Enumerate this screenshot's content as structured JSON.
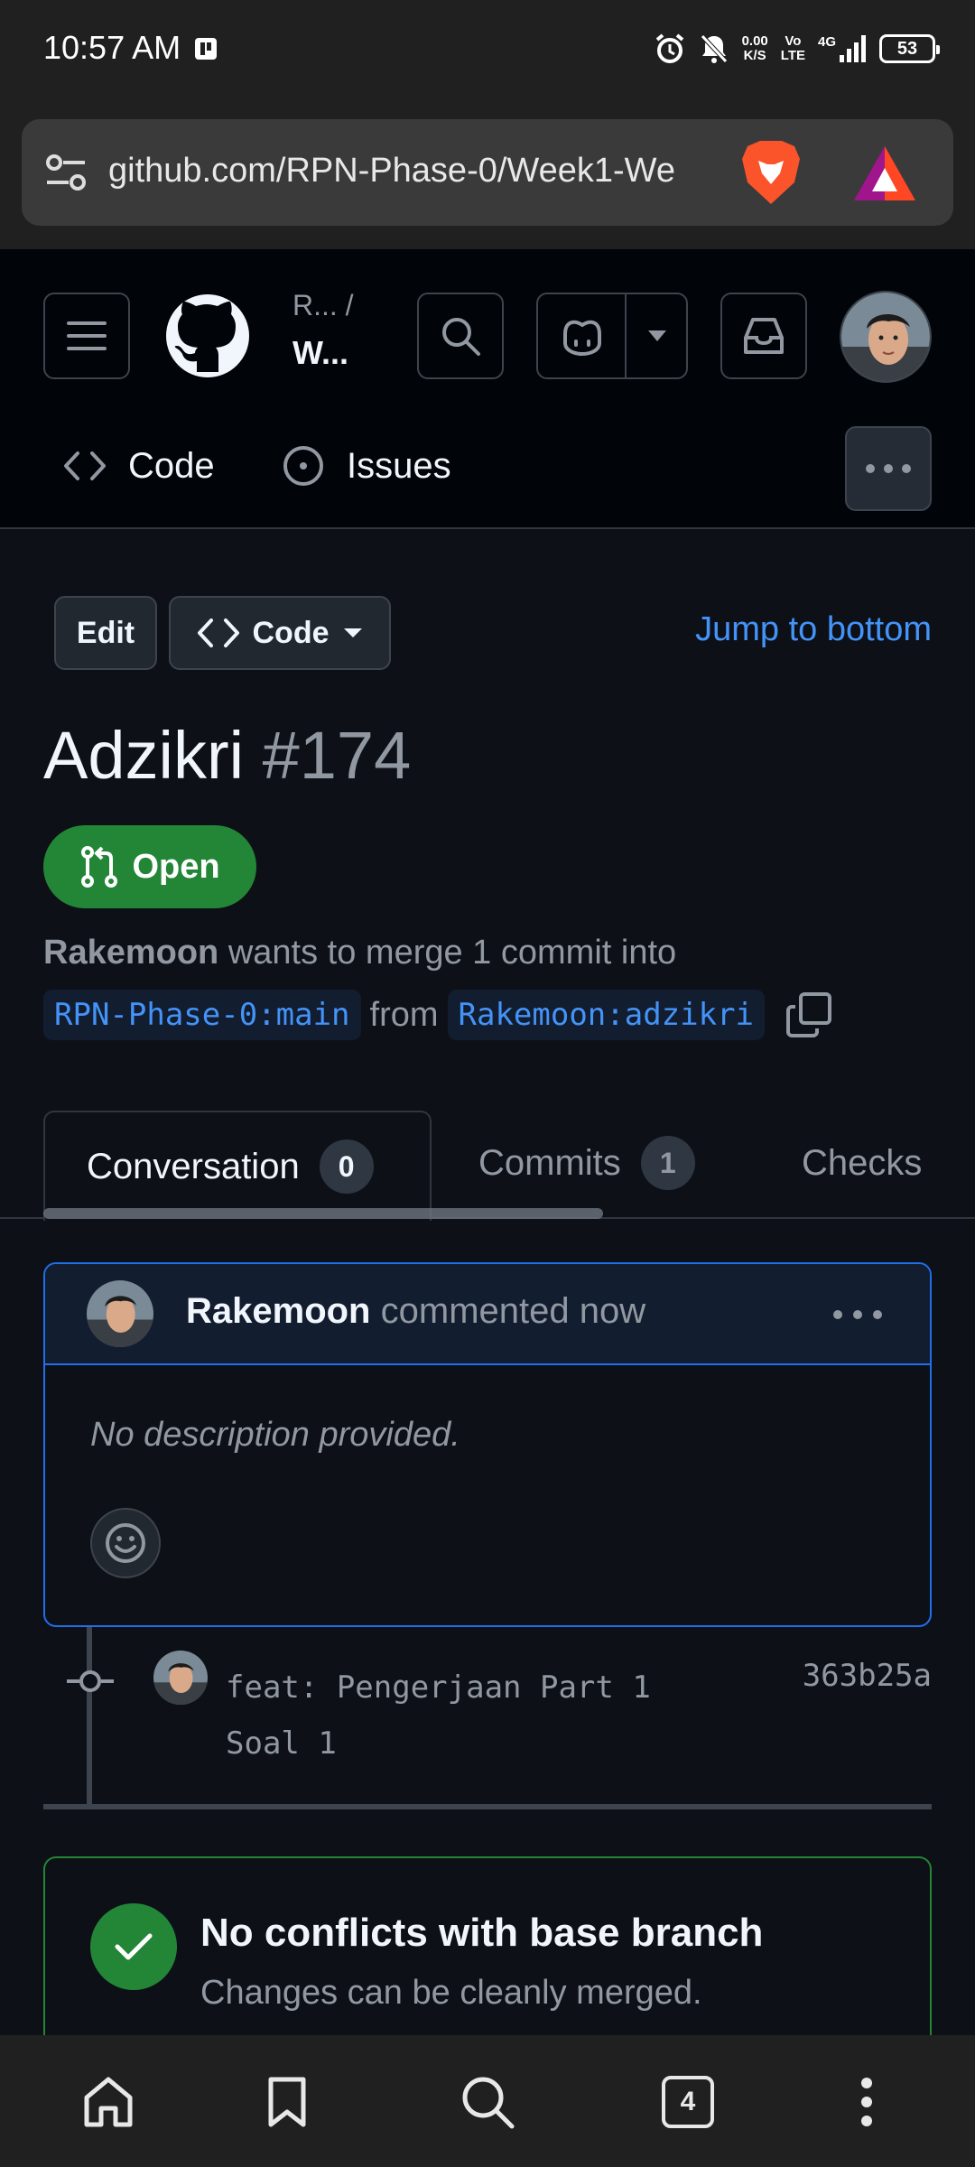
{
  "status_bar": {
    "time": "10:57 AM",
    "net_speed_value": "0.00",
    "net_speed_unit": "K/S",
    "volte_top": "Vo",
    "volte_bottom": "LTE",
    "network_type": "4G",
    "battery_level": "53"
  },
  "browser": {
    "url": "github.com/RPN-Phase-0/Week1-We",
    "open_tab_count": "4"
  },
  "github_header": {
    "owner_truncated": "R... /",
    "repo_truncated": "W..."
  },
  "repo_nav": {
    "code_label": "Code",
    "issues_label": "Issues"
  },
  "pr_actions": {
    "edit_label": "Edit",
    "code_label": "Code",
    "jump_label": "Jump to bottom"
  },
  "pull_request": {
    "title": "Adzikri",
    "number": "#174",
    "state": "Open",
    "author": "Rakemoon",
    "merge_text": "wants to merge 1 commit into",
    "base_branch": "RPN-Phase-0:main",
    "from_word": "from",
    "head_branch": "Rakemoon:adzikri"
  },
  "tabs": [
    {
      "label": "Conversation",
      "count": "0"
    },
    {
      "label": "Commits",
      "count": "1"
    },
    {
      "label": "Checks"
    }
  ],
  "comment": {
    "author": "Rakemoon",
    "action": "commented now",
    "body": "No description provided."
  },
  "commit": {
    "message": "feat: Pengerjaan Part 1\nSoal 1",
    "sha": "363b25a"
  },
  "merge_status": {
    "title": "No conflicts with base branch",
    "subtitle": "Changes can be cleanly merged."
  },
  "colors": {
    "accent_blue": "#4493f8",
    "open_green": "#238636",
    "background": "#0d1117"
  }
}
